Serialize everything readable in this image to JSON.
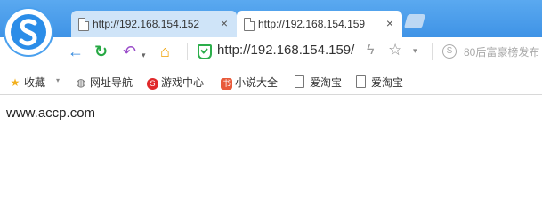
{
  "tabs": [
    {
      "title": "http://192.168.154.152",
      "close": "×",
      "active": false
    },
    {
      "title": "http://192.168.154.159",
      "close": "×",
      "active": true
    }
  ],
  "toolbar": {
    "back_icon": "←",
    "reload_icon": "↻",
    "undo_icon": "↶",
    "undo_caret": "▾",
    "home_icon": "⌂",
    "address": "http://192.168.154.159/",
    "bolt_icon": "ϟ",
    "star_icon": "☆",
    "caret": "▾",
    "search_badge": "S",
    "search_hint": "80后富豪榜发布"
  },
  "bookmarks": [
    {
      "label": "收藏",
      "icon": "★"
    },
    {
      "label": "网址导航",
      "icon": "◍"
    },
    {
      "label": "游戏中心",
      "icon": "S"
    },
    {
      "label": "小说大全",
      "icon": "书"
    },
    {
      "label": "爱淘宝",
      "icon": "page"
    },
    {
      "label": "爱淘宝",
      "icon": "page"
    }
  ],
  "bookmarks_caret": "▾",
  "content": {
    "text": "www.accp.com"
  },
  "colors": {
    "chrome": "#4a9eee",
    "active_tab": "#ffffff",
    "inactive_tab": "#cfe4f8"
  }
}
